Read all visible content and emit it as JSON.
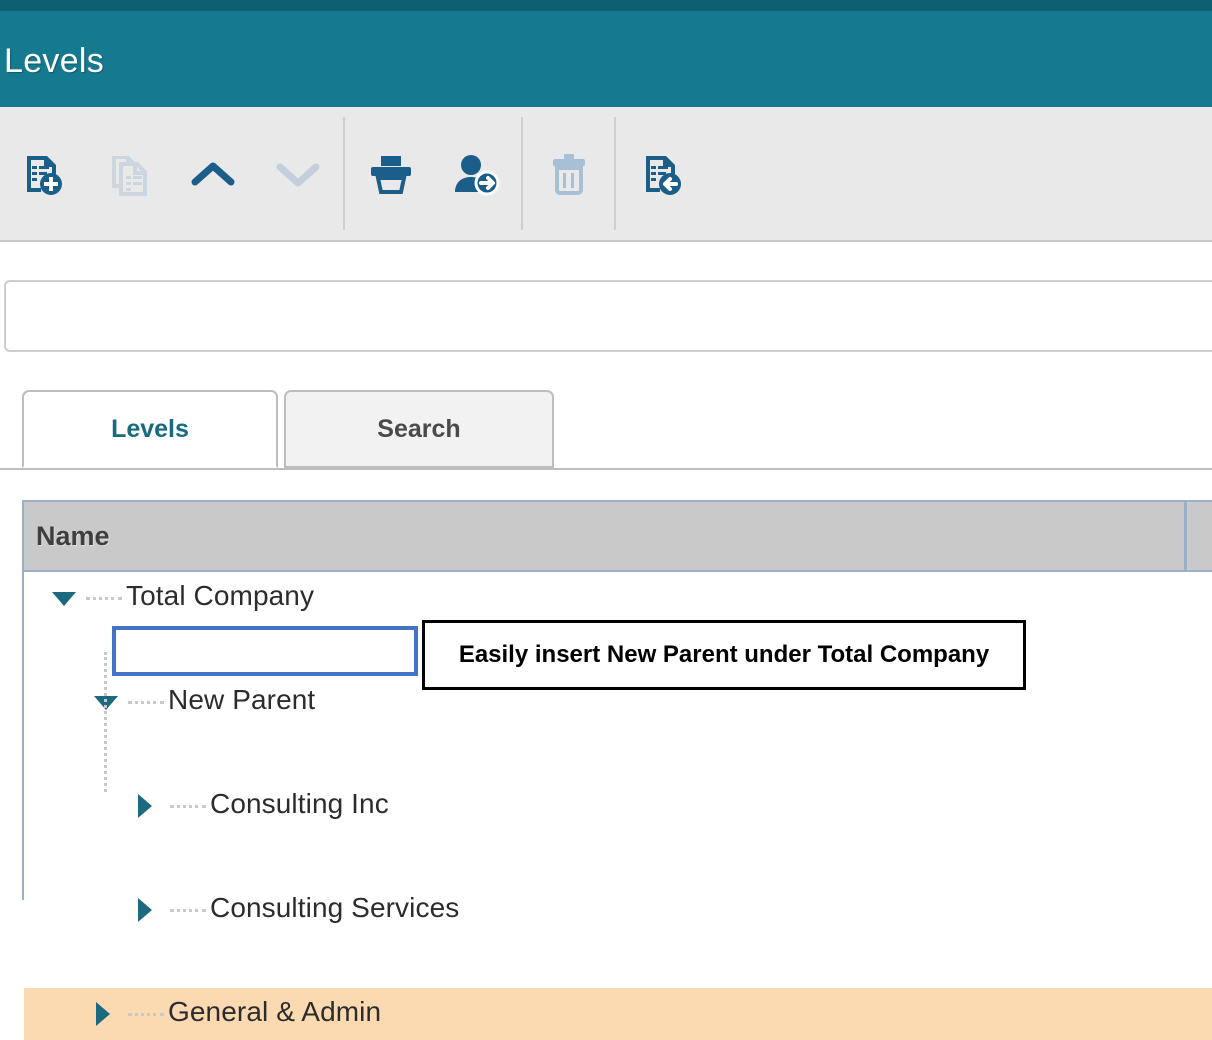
{
  "window": {
    "title": "Levels",
    "title_bar_color": "#15798f",
    "title_bar_accent": "#0f5f72"
  },
  "toolbar": {
    "buttons": [
      {
        "name": "new-level",
        "icon": "document-add-icon",
        "label": "New",
        "enabled": true
      },
      {
        "name": "copy-level",
        "icon": "document-copy-icon",
        "label": "Copy",
        "enabled": false
      },
      {
        "name": "move-up",
        "icon": "chevron-up-icon",
        "label": "Move Up",
        "enabled": true
      },
      {
        "name": "move-down",
        "icon": "chevron-down-icon",
        "label": "Move Down",
        "enabled": false
      },
      {
        "name": "print",
        "icon": "printer-icon",
        "label": "Print",
        "enabled": true
      },
      {
        "name": "assign-user",
        "icon": "user-add-icon",
        "label": "Assign User",
        "enabled": true
      },
      {
        "name": "delete",
        "icon": "trash-icon",
        "label": "Delete",
        "enabled": true
      },
      {
        "name": "insert-parent",
        "icon": "document-insert-left-icon",
        "label": "Insert Parent",
        "enabled": true
      }
    ]
  },
  "filter": {
    "value": "",
    "placeholder": ""
  },
  "tabs": [
    {
      "label": "Levels",
      "active": true
    },
    {
      "label": "Search",
      "active": false
    }
  ],
  "grid": {
    "columns": [
      "Name",
      ""
    ],
    "rows": [
      {
        "label": "Total Company",
        "depth": 0,
        "state": "expanded",
        "selected": false,
        "highlighted": false
      },
      {
        "label": "New Parent",
        "depth": 1,
        "state": "expanded",
        "selected": true,
        "highlighted": false
      },
      {
        "label": "Consulting Inc",
        "depth": 2,
        "state": "collapsed",
        "selected": false,
        "highlighted": false
      },
      {
        "label": "Consulting Services",
        "depth": 2,
        "state": "collapsed",
        "selected": false,
        "highlighted": false
      },
      {
        "label": "General & Admin",
        "depth": 1,
        "state": "collapsed",
        "selected": false,
        "highlighted": true
      }
    ],
    "header_background": "#c9c9c9",
    "highlight_color": "#fbd9b1",
    "selection_border_color": "#4472c4"
  },
  "callout": {
    "text": "Easily insert New Parent under Total Company",
    "border_color": "#000000"
  }
}
